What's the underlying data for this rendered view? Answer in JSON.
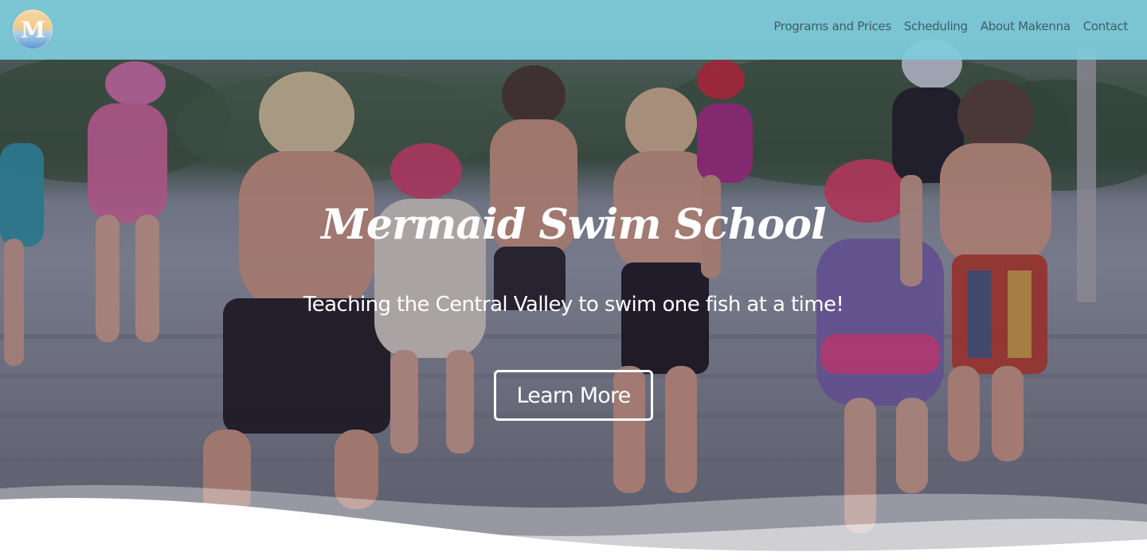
{
  "site": {
    "logo_letter": "M",
    "brand_colors": {
      "nav_background": "#7dcbdc",
      "nav_text": "#3f5f66",
      "hero_text": "#ffffff"
    }
  },
  "nav": {
    "items": [
      {
        "label": "Programs and Prices"
      },
      {
        "label": "Scheduling"
      },
      {
        "label": "About Makenna"
      },
      {
        "label": "Contact"
      }
    ]
  },
  "hero": {
    "title": "Mermaid Swim School",
    "tagline": "Teaching the Central Valley to swim one fish at a time!",
    "cta_label": "Learn More"
  }
}
